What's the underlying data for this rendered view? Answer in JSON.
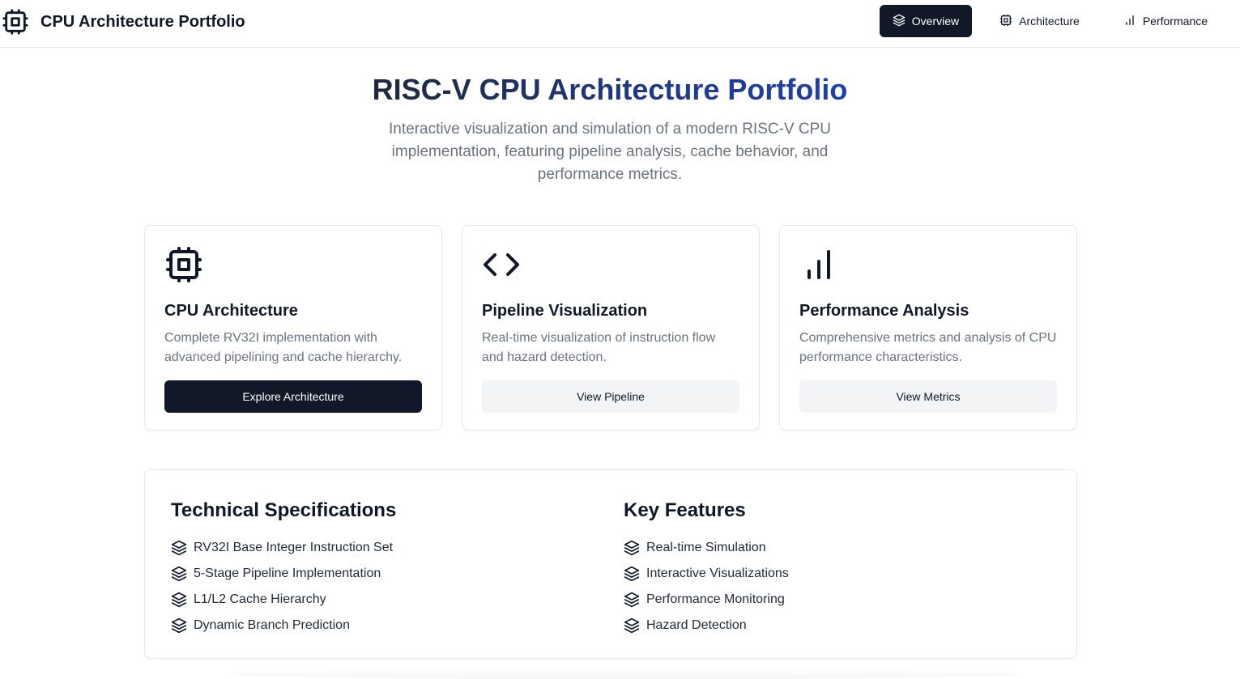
{
  "header": {
    "brand_icon": "cpu-icon",
    "title": "CPU Architecture Portfolio",
    "nav": [
      {
        "label": "Overview",
        "icon": "layers-icon",
        "active": true
      },
      {
        "label": "Architecture",
        "icon": "cpu-icon",
        "active": false
      },
      {
        "label": "Performance",
        "icon": "bar-chart-icon",
        "active": false
      }
    ]
  },
  "hero": {
    "title": "RISC-V CPU Architecture Portfolio",
    "subtitle": "Interactive visualization and simulation of a modern RISC-V CPU implementation, featuring pipeline analysis, cache behavior, and performance metrics."
  },
  "cards": [
    {
      "icon": "cpu-icon",
      "title": "CPU Architecture",
      "description": "Complete RV32I implementation with advanced pipelining and cache hierarchy.",
      "button": "Explore Architecture",
      "style": "primary"
    },
    {
      "icon": "code-icon",
      "title": "Pipeline Visualization",
      "description": "Real-time visualization of instruction flow and hazard detection.",
      "button": "View Pipeline",
      "style": "secondary"
    },
    {
      "icon": "bar-chart-icon",
      "title": "Performance Analysis",
      "description": "Comprehensive metrics and analysis of CPU performance characteristics.",
      "button": "View Metrics",
      "style": "secondary"
    }
  ],
  "specs": {
    "title": "Technical Specifications",
    "items": [
      "RV32I Base Integer Instruction Set",
      "5-Stage Pipeline Implementation",
      "L1/L2 Cache Hierarchy",
      "Dynamic Branch Prediction"
    ]
  },
  "features": {
    "title": "Key Features",
    "items": [
      "Real-time Simulation",
      "Interactive Visualizations",
      "Performance Monitoring",
      "Hazard Detection"
    ]
  },
  "colors": {
    "primary": "#111827",
    "title_gradient_start": "#1e293b",
    "title_gradient_end": "#1e40af",
    "muted_text": "#6b7280",
    "border": "#e5e7eb"
  }
}
